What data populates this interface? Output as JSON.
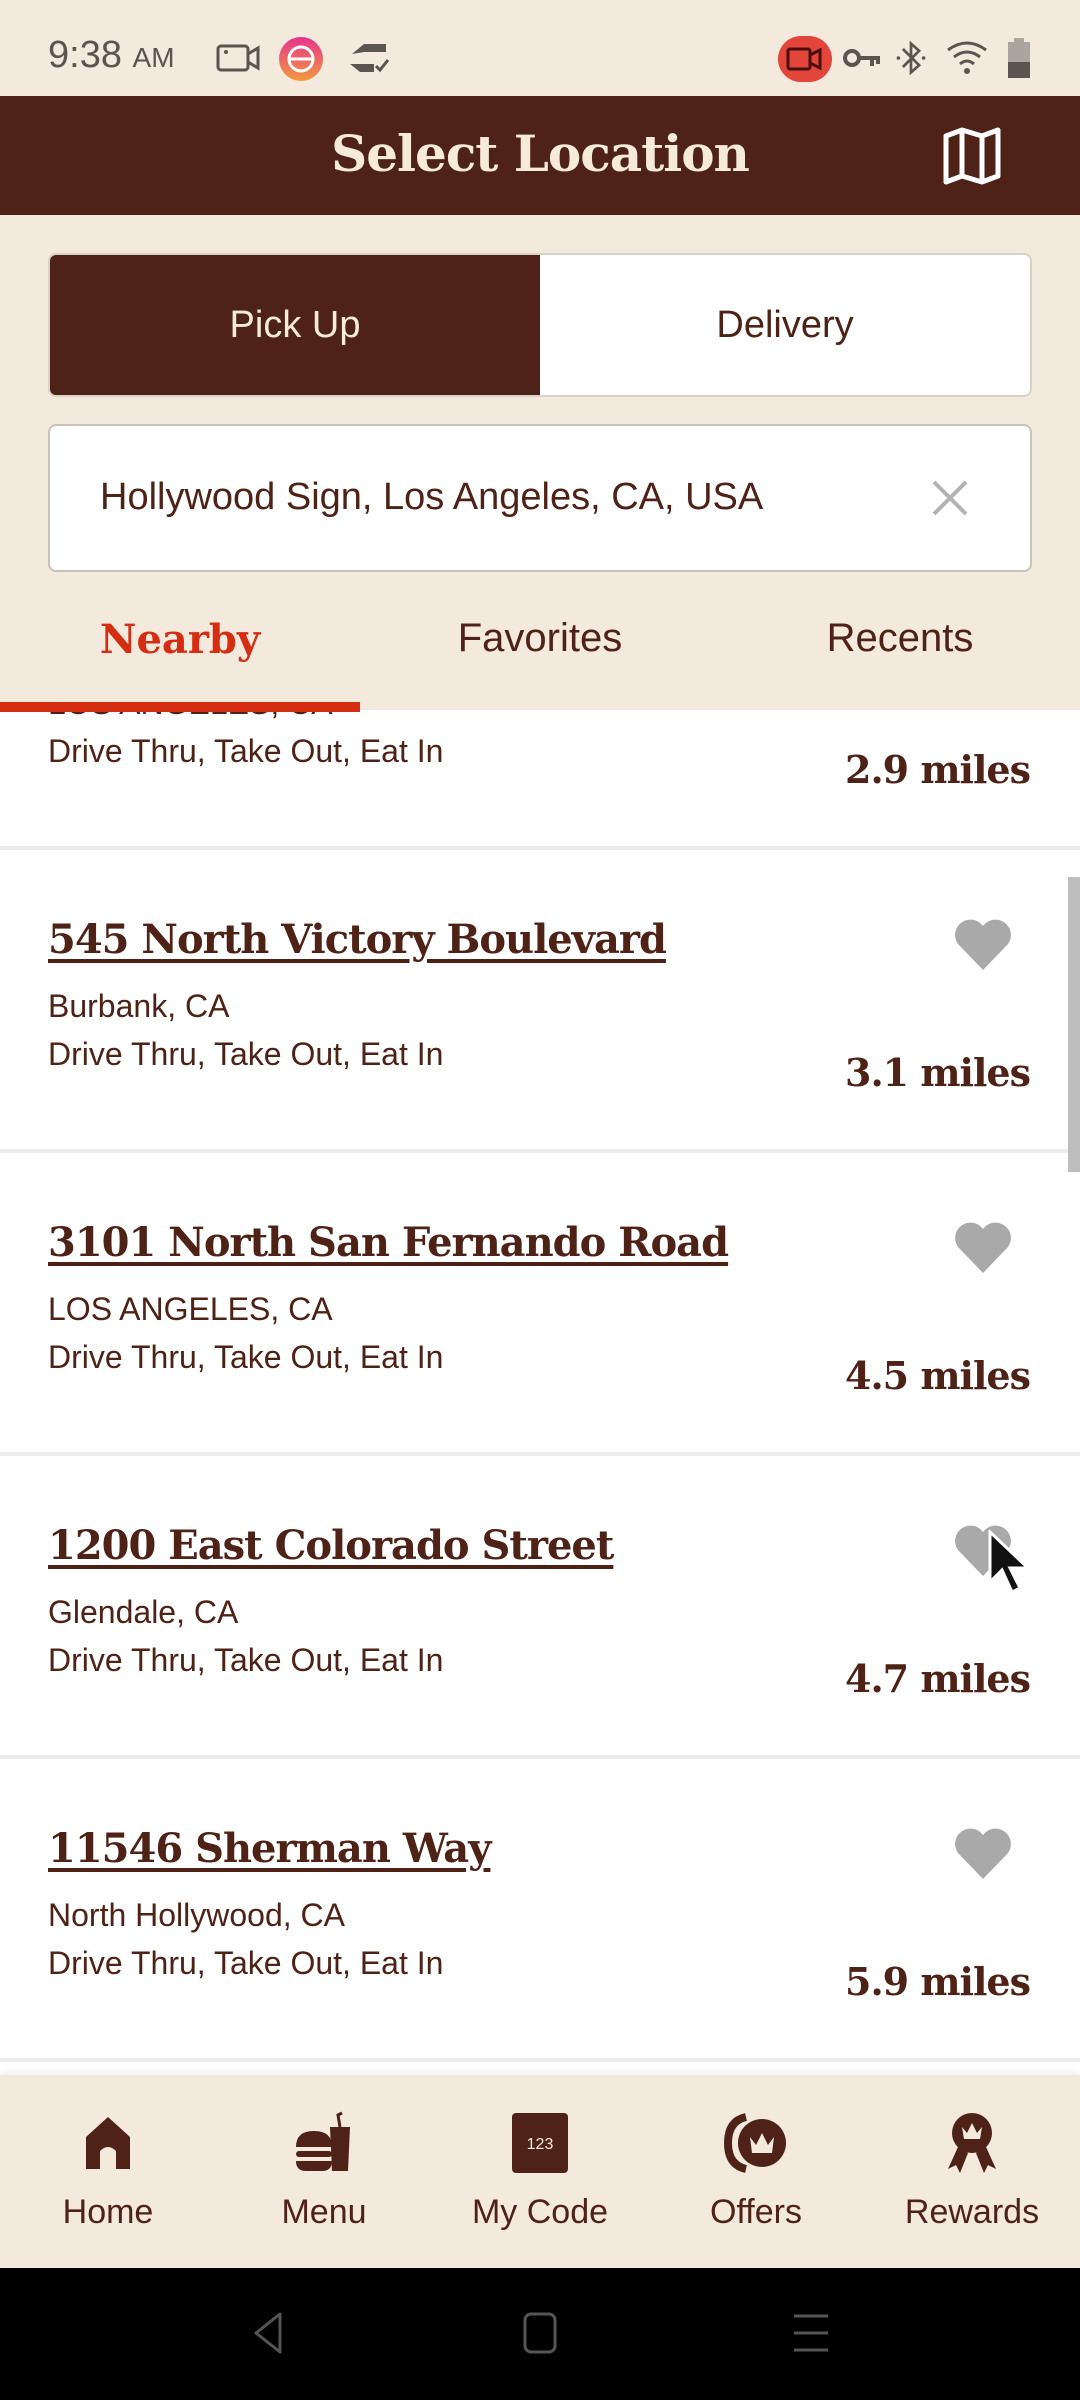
{
  "status_bar": {
    "time": "9:38",
    "ampm": "AM",
    "left_icons": [
      "screen-record-icon",
      "app-notification-icon",
      "sync-icon"
    ],
    "right_icons": [
      "recording-indicator-icon",
      "vpn-key-icon",
      "bluetooth-icon",
      "wifi-icon",
      "battery-icon"
    ]
  },
  "header": {
    "title": "Select Location",
    "map_icon": "map-icon"
  },
  "order_type": {
    "options": [
      "Pick Up",
      "Delivery"
    ],
    "selected": "Pick Up"
  },
  "search": {
    "value": "Hollywood Sign, Los Angeles, CA, USA",
    "clear_icon": "close-icon"
  },
  "tabs": {
    "items": [
      "Nearby",
      "Favorites",
      "Recents"
    ],
    "active": "Nearby"
  },
  "locations": [
    {
      "title": "",
      "city": "LOS ANGELES, CA",
      "services": "Drive Thru, Take Out, Eat In",
      "distance": "2.9 miles",
      "partial": true
    },
    {
      "title": "545 North Victory Boulevard",
      "city": "Burbank, CA",
      "services": "Drive Thru, Take Out, Eat In",
      "distance": "3.1 miles",
      "favorite": false
    },
    {
      "title": "3101 North San Fernando Road",
      "city": "LOS ANGELES, CA",
      "services": "Drive Thru, Take Out, Eat In",
      "distance": "4.5 miles",
      "favorite": false
    },
    {
      "title": "1200 East Colorado Street",
      "city": "Glendale, CA",
      "services": "Drive Thru, Take Out, Eat In",
      "distance": "4.7 miles",
      "favorite": false
    },
    {
      "title": "11546 Sherman Way",
      "city": "North Hollywood, CA",
      "services": "Drive Thru, Take Out, Eat In",
      "distance": "5.9 miles",
      "favorite": false
    }
  ],
  "bottom_nav": {
    "items": [
      {
        "label": "Home",
        "icon": "home-icon"
      },
      {
        "label": "Menu",
        "icon": "menu-food-icon"
      },
      {
        "label": "My Code",
        "icon": "code-icon",
        "icon_text": "123"
      },
      {
        "label": "Offers",
        "icon": "offers-icon"
      },
      {
        "label": "Rewards",
        "icon": "rewards-icon"
      }
    ]
  },
  "colors": {
    "brand_brown": "#4e2216",
    "background_cream": "#f3e9dc",
    "accent_red": "#d42d11",
    "heart_gray": "#a9a9a9"
  }
}
